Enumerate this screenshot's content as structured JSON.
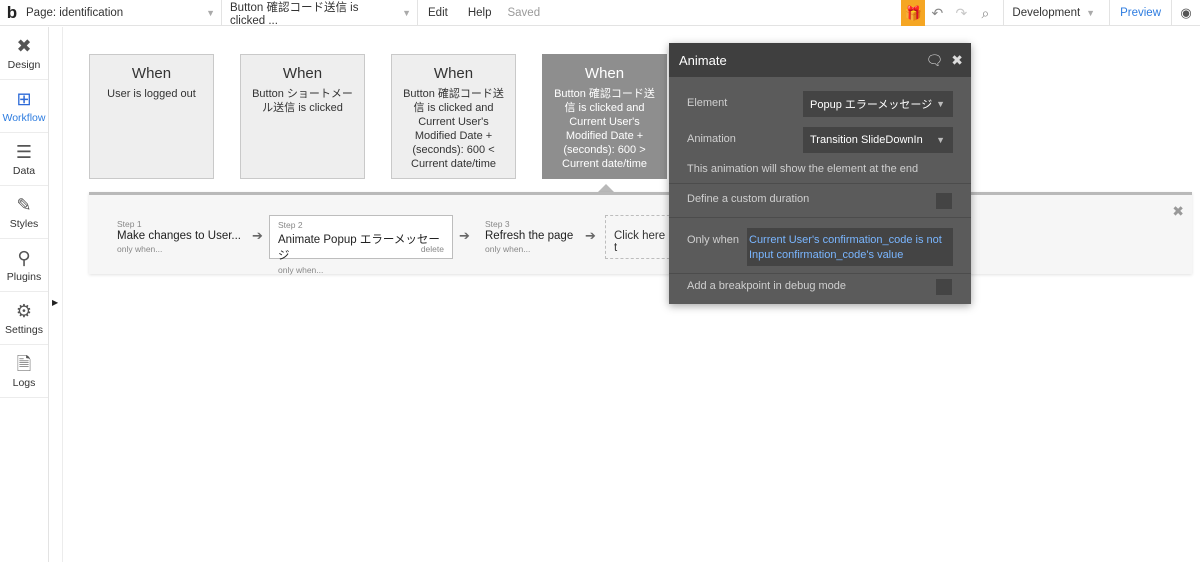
{
  "topbar": {
    "logo": "b",
    "page_label": "Page: identification",
    "element_label": "Button 確認コード送信 is clicked ...",
    "menu": [
      "Edit",
      "Help"
    ],
    "status": "Saved",
    "environment": "Development",
    "preview": "Preview"
  },
  "sidebar": {
    "items": [
      {
        "label": "Design",
        "icon": "design-icon"
      },
      {
        "label": "Workflow",
        "icon": "workflow-icon"
      },
      {
        "label": "Data",
        "icon": "data-icon"
      },
      {
        "label": "Styles",
        "icon": "styles-icon"
      },
      {
        "label": "Plugins",
        "icon": "plugins-icon"
      },
      {
        "label": "Settings",
        "icon": "settings-icon"
      },
      {
        "label": "Logs",
        "icon": "logs-icon"
      }
    ],
    "active": "Workflow"
  },
  "events": [
    {
      "when": "When",
      "desc": "User is logged out"
    },
    {
      "when": "When",
      "desc": "Button ショートメール送信 is clicked"
    },
    {
      "when": "When",
      "desc": "Button 確認コード送信 is clicked and Current User's Modified Date + (seconds): 600 < Current date/time"
    },
    {
      "when": "When",
      "desc": "Button 確認コード送信 is clicked and Current User's Modified Date + (seconds): 600 > Current date/time"
    }
  ],
  "steps": [
    {
      "num": "Step 1",
      "title": "Make changes to User...",
      "sub": "only when..."
    },
    {
      "num": "Step 2",
      "title": "Animate Popup エラーメッセージ",
      "sub": "only when...",
      "delete": "delete"
    },
    {
      "num": "Step 3",
      "title": "Refresh the page",
      "sub": "only when..."
    }
  ],
  "add_step": "Click here t",
  "dialog": {
    "title": "Animate",
    "element_label": "Element",
    "element_value": "Popup エラーメッセージ",
    "animation_label": "Animation",
    "animation_value": "Transition SlideDownIn",
    "note": "This animation will show the element at the end",
    "custom_duration": "Define a custom duration",
    "only_when_label": "Only when",
    "only_when_value": "Current User's confirmation_code is not Input confirmation_code's value",
    "breakpoint": "Add a breakpoint in debug mode"
  }
}
